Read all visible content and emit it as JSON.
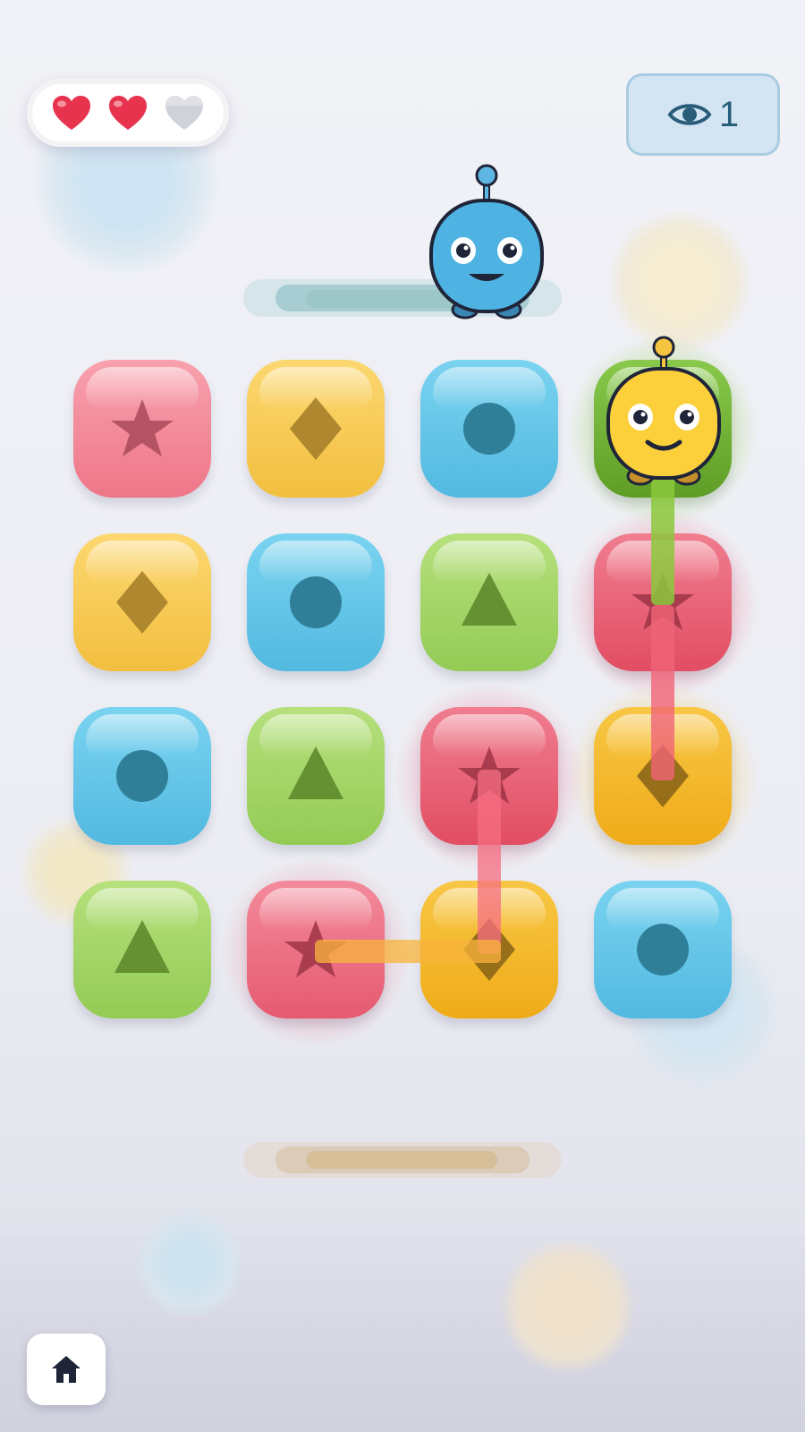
{
  "hud": {
    "lives": {
      "total": 3,
      "remaining": 2
    },
    "peek": {
      "icon": "eye-icon",
      "count": "1"
    }
  },
  "colors": {
    "pink": "#f07a8c",
    "yellow": "#f5c542",
    "blue": "#5ec4e6",
    "green": "#9dd25c",
    "red": "#ea5a6e",
    "deep_yellow": "#f2b522"
  },
  "board": {
    "rows": 4,
    "cols": 4,
    "tiles": [
      [
        "pink-star",
        "yellow-diamond",
        "blue-circle",
        "green-square"
      ],
      [
        "yellow-diamond",
        "blue-circle",
        "green-triangle",
        "red-star"
      ],
      [
        "blue-circle",
        "green-triangle",
        "red-star",
        "yellow-diamond"
      ],
      [
        "green-triangle",
        "red-star",
        "yellow-diamond",
        "blue-circle"
      ]
    ]
  },
  "characters": [
    {
      "name": "blue-robot",
      "color": "blue",
      "position": "top-start-pad"
    },
    {
      "name": "yellow-robot",
      "color": "yellow",
      "position": "row-1-col-4"
    }
  ],
  "nav": {
    "home_icon": "home-icon"
  }
}
